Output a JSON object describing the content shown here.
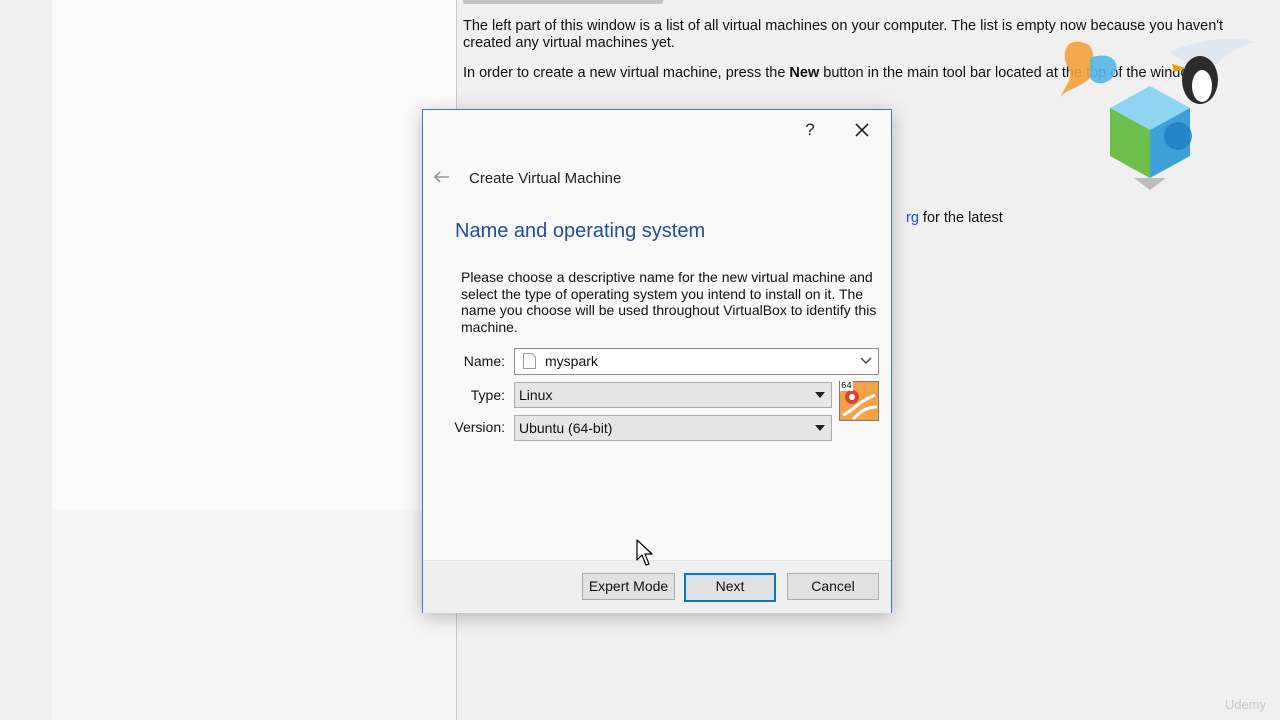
{
  "background": {
    "welcome_p1": "The left part of this window is a list of all virtual machines on your computer. The list is empty now because you haven't created any virtual machines yet.",
    "welcome_p2_before": "In order to create a new virtual machine, press the ",
    "welcome_p2_bold": "New",
    "welcome_p2_after": " button in the main tool bar located at the top of the window.",
    "welcome_p3_link": "rg",
    "welcome_p3_after": " for the latest",
    "watermark": "Udemy"
  },
  "dialog": {
    "help_label": "?",
    "title": "Create Virtual Machine",
    "section_title": "Name and operating system",
    "description": "Please choose a descriptive name for the new virtual machine and select the type of operating system you intend to install on it. The name you choose will be used throughout VirtualBox to identify this machine.",
    "name_label": "Name:",
    "name_value": "myspark",
    "type_label": "Type:",
    "type_value": "Linux",
    "version_label": "Version:",
    "version_value": "Ubuntu (64-bit)",
    "os_badge": "64",
    "buttons": {
      "expert": "Expert Mode",
      "next": "Next",
      "cancel": "Cancel"
    }
  },
  "colors": {
    "accent": "#0078d7",
    "section_title": "#1f4e9b",
    "dialog_border": "#3c78d8"
  }
}
